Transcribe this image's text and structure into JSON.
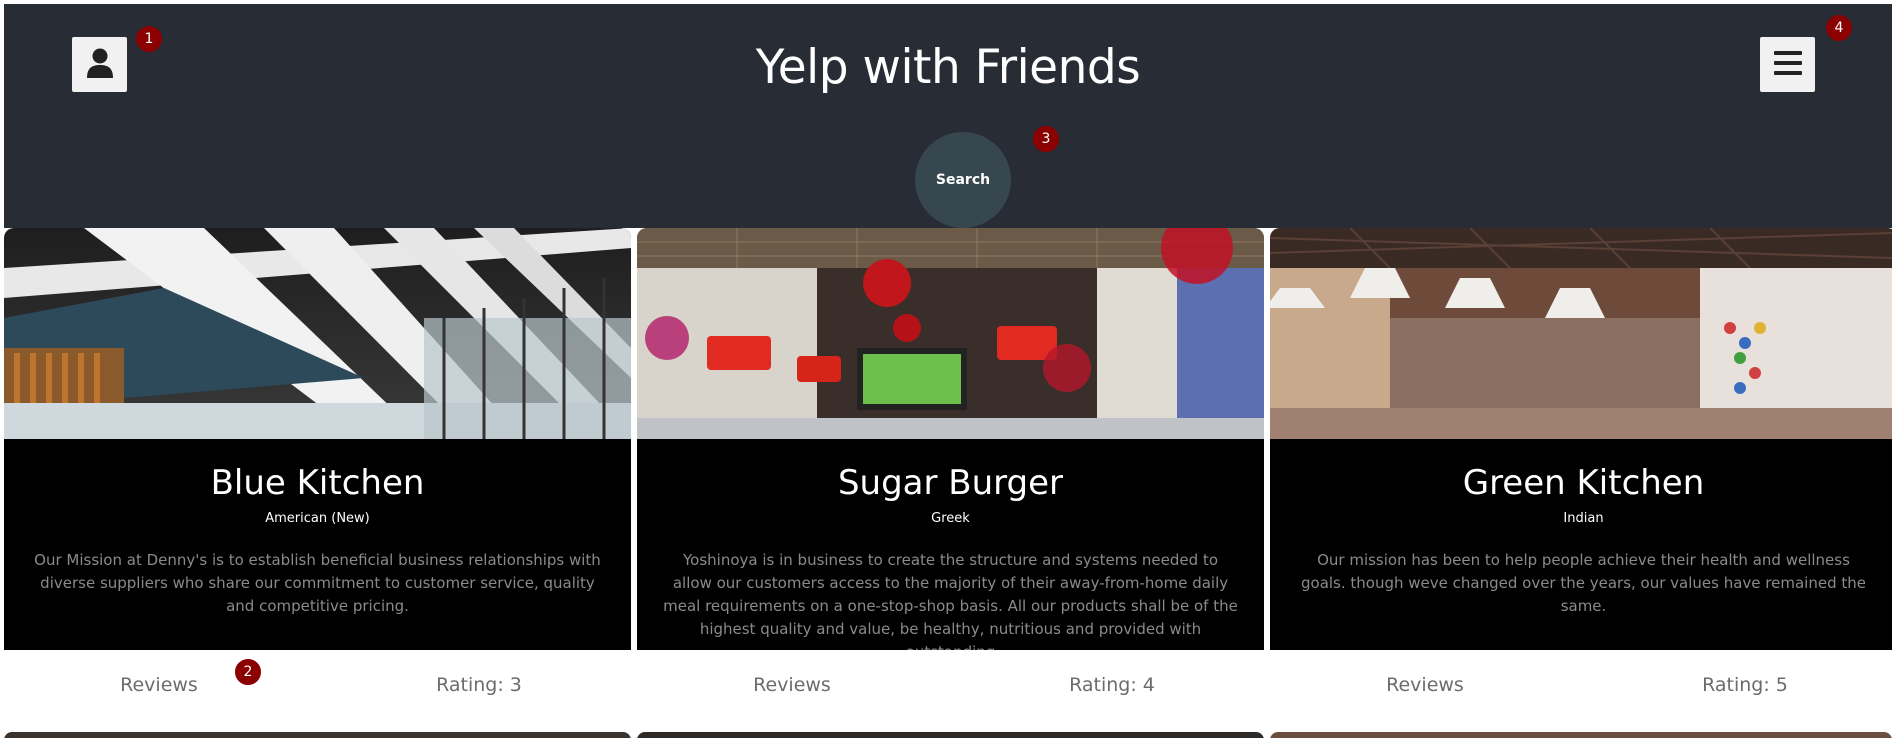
{
  "header": {
    "title": "Yelp with Friends",
    "search_label": "Search",
    "user_icon": "user-icon",
    "menu_icon": "hamburger-menu-icon"
  },
  "badges": [
    "1",
    "2",
    "3",
    "4"
  ],
  "cards": [
    {
      "name": "Blue Kitchen",
      "cuisine": "American (New)",
      "description": "Our Mission at Denny's is to establish beneficial business relationships with diverse suppliers who share our commitment to customer service, quality and competitive pricing.",
      "reviews_label": "Reviews",
      "rating": "Rating: 3"
    },
    {
      "name": "Sugar Burger",
      "cuisine": "Greek",
      "description": "Yoshinoya is in business to create the structure and systems needed to allow our customers access to the majority of their away-from-home daily meal requirements on a one-stop-shop basis. All our products shall be of the highest quality and value, be healthy, nutritious and provided with outstanding",
      "reviews_label": "Reviews",
      "rating": "Rating: 4"
    },
    {
      "name": "Green Kitchen",
      "cuisine": "Indian",
      "description": "Our mission has been to help people achieve their health and wellness goals. though weve changed over the years, our values have remained the same.",
      "reviews_label": "Reviews",
      "rating": "Rating: 5"
    }
  ],
  "colors": {
    "header_bg": "#272c35",
    "search_bg": "#37474f",
    "badge": "#8b0000",
    "card_body": "#000000"
  }
}
